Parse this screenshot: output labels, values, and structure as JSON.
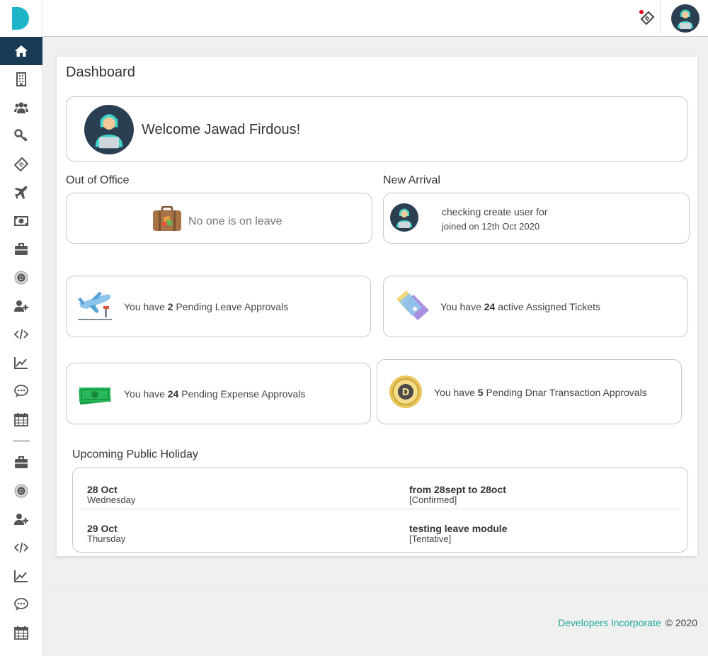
{
  "header": {
    "notification_icon": "ticket-icon",
    "avatar_icon": "user-avatar"
  },
  "sidebar": {
    "items": [
      {
        "icon": "home-icon",
        "active": true
      },
      {
        "icon": "building-icon"
      },
      {
        "icon": "users-icon"
      },
      {
        "icon": "key-icon"
      },
      {
        "icon": "ticket-icon"
      },
      {
        "icon": "plane-icon"
      },
      {
        "icon": "money-icon"
      },
      {
        "icon": "briefcase-icon"
      },
      {
        "icon": "coin-icon"
      },
      {
        "icon": "user-plus-icon"
      },
      {
        "icon": "code-icon"
      },
      {
        "icon": "chart-line-icon"
      },
      {
        "icon": "comments-icon"
      },
      {
        "icon": "calendar-icon"
      },
      {
        "icon": "briefcase-icon"
      },
      {
        "icon": "coin-icon"
      },
      {
        "icon": "user-plus-icon"
      },
      {
        "icon": "code-icon"
      },
      {
        "icon": "chart-line-icon"
      },
      {
        "icon": "comments-icon"
      },
      {
        "icon": "calendar-icon"
      }
    ]
  },
  "main": {
    "title": "Dashboard",
    "welcome": "Welcome Jawad Firdous!",
    "out_of_office": {
      "label": "Out of Office",
      "message": "No one is on leave"
    },
    "new_arrival": {
      "label": "New Arrival",
      "name": "checking create user for",
      "joined": "joined on 12th Oct 2020"
    },
    "stats": {
      "leave": {
        "prefix": "You have",
        "count": "2",
        "suffix": "Pending Leave Approvals"
      },
      "tickets": {
        "prefix": "You have",
        "count": "24",
        "suffix": "active Assigned Tickets"
      },
      "expense": {
        "prefix": "You have",
        "count": "24",
        "suffix": "Pending Expense Approvals"
      },
      "dnar": {
        "prefix": "You have",
        "count": "5",
        "suffix": "Pending Dnar Transaction Approvals"
      }
    },
    "holidays": {
      "label": "Upcoming Public Holiday",
      "rows": [
        {
          "date": "28 Oct",
          "day": "Wednesday",
          "title": "from 28sept to 28oct",
          "status": "[Confirmed]"
        },
        {
          "date": "29 Oct",
          "day": "Thursday",
          "title": "testing leave module",
          "status": "[Tentative]"
        }
      ]
    }
  },
  "footer": {
    "company": "Developers Incorporate",
    "copyright": "© 2020"
  },
  "colors": {
    "sidebar_active": "#183b54",
    "brand": "#1fb5c9",
    "link": "#1ea89b"
  }
}
